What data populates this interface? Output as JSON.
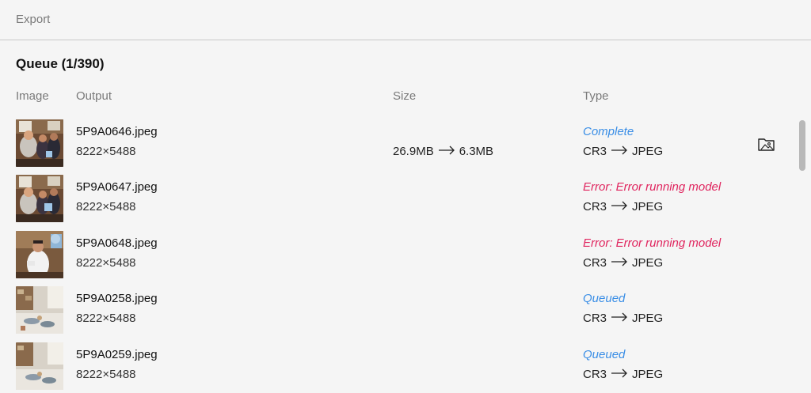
{
  "window": {
    "title": "Export"
  },
  "queue": {
    "title": "Queue (1/390)"
  },
  "columns": {
    "image": "Image",
    "output": "Output",
    "size": "Size",
    "type": "Type"
  },
  "colors": {
    "status_blue": "#3a8ee6",
    "status_error": "#e0245e"
  },
  "rows": [
    {
      "filename": "5P9A0646.jpeg",
      "dimensions": "8222×5488",
      "size_from": "26.9MB",
      "size_to": "6.3MB",
      "status": "Complete",
      "status_kind": "info",
      "type_from": "CR3",
      "type_to": "JPEG",
      "thumb_icon": "group-photo-thumbnail"
    },
    {
      "filename": "5P9A0647.jpeg",
      "dimensions": "8222×5488",
      "size_from": "",
      "size_to": "",
      "status": "Error: Error running model",
      "status_kind": "error",
      "type_from": "CR3",
      "type_to": "JPEG",
      "thumb_icon": "group-photo-thumbnail"
    },
    {
      "filename": "5P9A0648.jpeg",
      "dimensions": "8222×5488",
      "size_from": "",
      "size_to": "",
      "status": "Error: Error running model",
      "status_kind": "error",
      "type_from": "CR3",
      "type_to": "JPEG",
      "thumb_icon": "portrait-photo-thumbnail"
    },
    {
      "filename": "5P9A0258.jpeg",
      "dimensions": "8222×5488",
      "size_from": "",
      "size_to": "",
      "status": "Queued",
      "status_kind": "info",
      "type_from": "CR3",
      "type_to": "JPEG",
      "thumb_icon": "table-photo-thumbnail"
    },
    {
      "filename": "5P9A0259.jpeg",
      "dimensions": "8222×5488",
      "size_from": "",
      "size_to": "",
      "status": "Queued",
      "status_kind": "info",
      "type_from": "CR3",
      "type_to": "JPEG",
      "thumb_icon": "table-photo-thumbnail"
    }
  ],
  "icons": {
    "arrow": "long-right-arrow-icon",
    "open_folder": "image-folder-icon"
  }
}
